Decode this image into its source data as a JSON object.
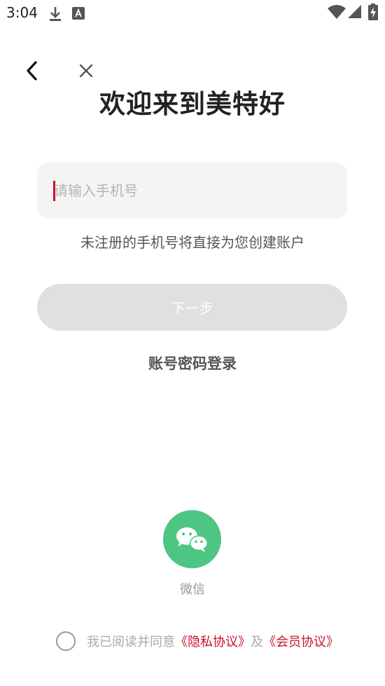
{
  "status_bar": {
    "time": "3:04",
    "icons": [
      "download-icon",
      "a-badge-icon",
      "wifi-icon",
      "signal-icon",
      "battery-charging-icon"
    ]
  },
  "header": {
    "back_icon": "chevron-left-icon",
    "close_icon": "close-icon",
    "title": "欢迎来到美特好"
  },
  "form": {
    "phone_placeholder": "请输入手机号",
    "phone_value": "",
    "hint": "未注册的手机号将直接为您创建账户",
    "next_label": "下一步"
  },
  "alt_login": {
    "password_login_label": "账号密码登录",
    "wechat_label": "微信",
    "wechat_icon": "wechat-icon"
  },
  "agreement": {
    "prefix": "我已阅读并同意",
    "privacy_link": "《隐私协议》",
    "conjunction": "及",
    "member_link": "《会员协议》",
    "checked": false
  },
  "colors": {
    "accent": "#c8102e",
    "wechat_green": "#4cc681",
    "disabled_button": "#e0e0e0",
    "input_bg": "#f4f4f4"
  }
}
